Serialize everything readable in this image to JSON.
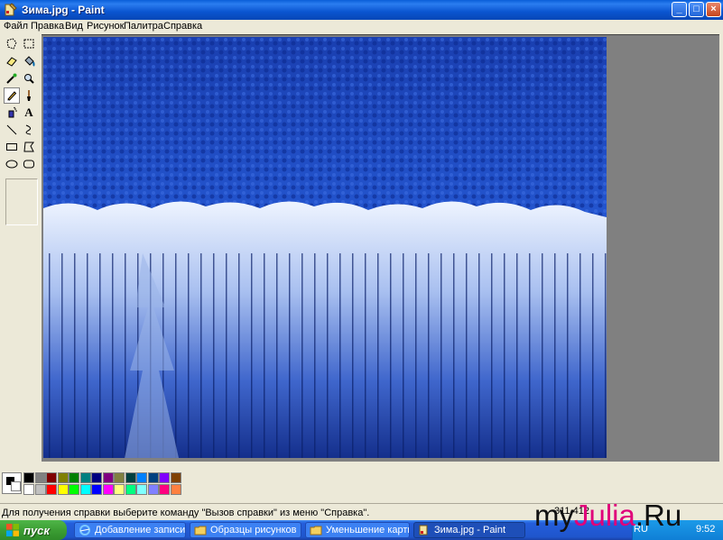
{
  "window": {
    "title": "Зима.jpg - Paint"
  },
  "title_buttons": {
    "minimize": "_",
    "maximize": "□",
    "close": "×"
  },
  "menu": [
    "Файл",
    "Правка",
    "Вид",
    "Рисунок",
    "Палитра",
    "Справка"
  ],
  "tools": [
    {
      "name": "free-select-icon"
    },
    {
      "name": "rect-select-icon"
    },
    {
      "name": "eraser-icon"
    },
    {
      "name": "fill-icon"
    },
    {
      "name": "color-picker-icon"
    },
    {
      "name": "magnifier-icon"
    },
    {
      "name": "pencil-icon",
      "selected": true
    },
    {
      "name": "brush-icon"
    },
    {
      "name": "airbrush-icon"
    },
    {
      "name": "text-icon",
      "glyph": "A"
    },
    {
      "name": "line-icon"
    },
    {
      "name": "curve-icon"
    },
    {
      "name": "rectangle-icon"
    },
    {
      "name": "polygon-icon"
    },
    {
      "name": "ellipse-icon"
    },
    {
      "name": "rounded-rect-icon"
    }
  ],
  "palette": {
    "foreground": "#000000",
    "background": "#ffffff",
    "row1": [
      "#000000",
      "#808080",
      "#800000",
      "#808000",
      "#008000",
      "#008080",
      "#000080",
      "#800080",
      "#808040",
      "#004040",
      "#0080ff",
      "#004080",
      "#8000ff",
      "#804000"
    ],
    "row2": [
      "#ffffff",
      "#c0c0c0",
      "#ff0000",
      "#ffff00",
      "#00ff00",
      "#00ffff",
      "#0000ff",
      "#ff00ff",
      "#ffff80",
      "#00ff80",
      "#80ffff",
      "#8080ff",
      "#ff0080",
      "#ff8040"
    ]
  },
  "status": {
    "help_text": "Для получения справки выберите команду \"Вызов справки\" из меню \"Справка\".",
    "coords": "311,412"
  },
  "taskbar": {
    "start_label": "пуск",
    "tasks": [
      {
        "label": "Добавление записи ..."
      },
      {
        "label": "Образцы рисунков"
      },
      {
        "label": "Уменьшение картинок"
      },
      {
        "label": "Зима.jpg - Paint",
        "active": true
      }
    ],
    "lang": "RU",
    "clock": "9:52"
  },
  "watermark": {
    "prefix": "my",
    "accent": "Julia",
    "suffix": ".Ru"
  },
  "colors": {
    "title_blue": "#0a55d0",
    "xp_beige": "#ece9d8",
    "canvas_gray": "#808080",
    "snow_blue": "#1a3fb8"
  }
}
